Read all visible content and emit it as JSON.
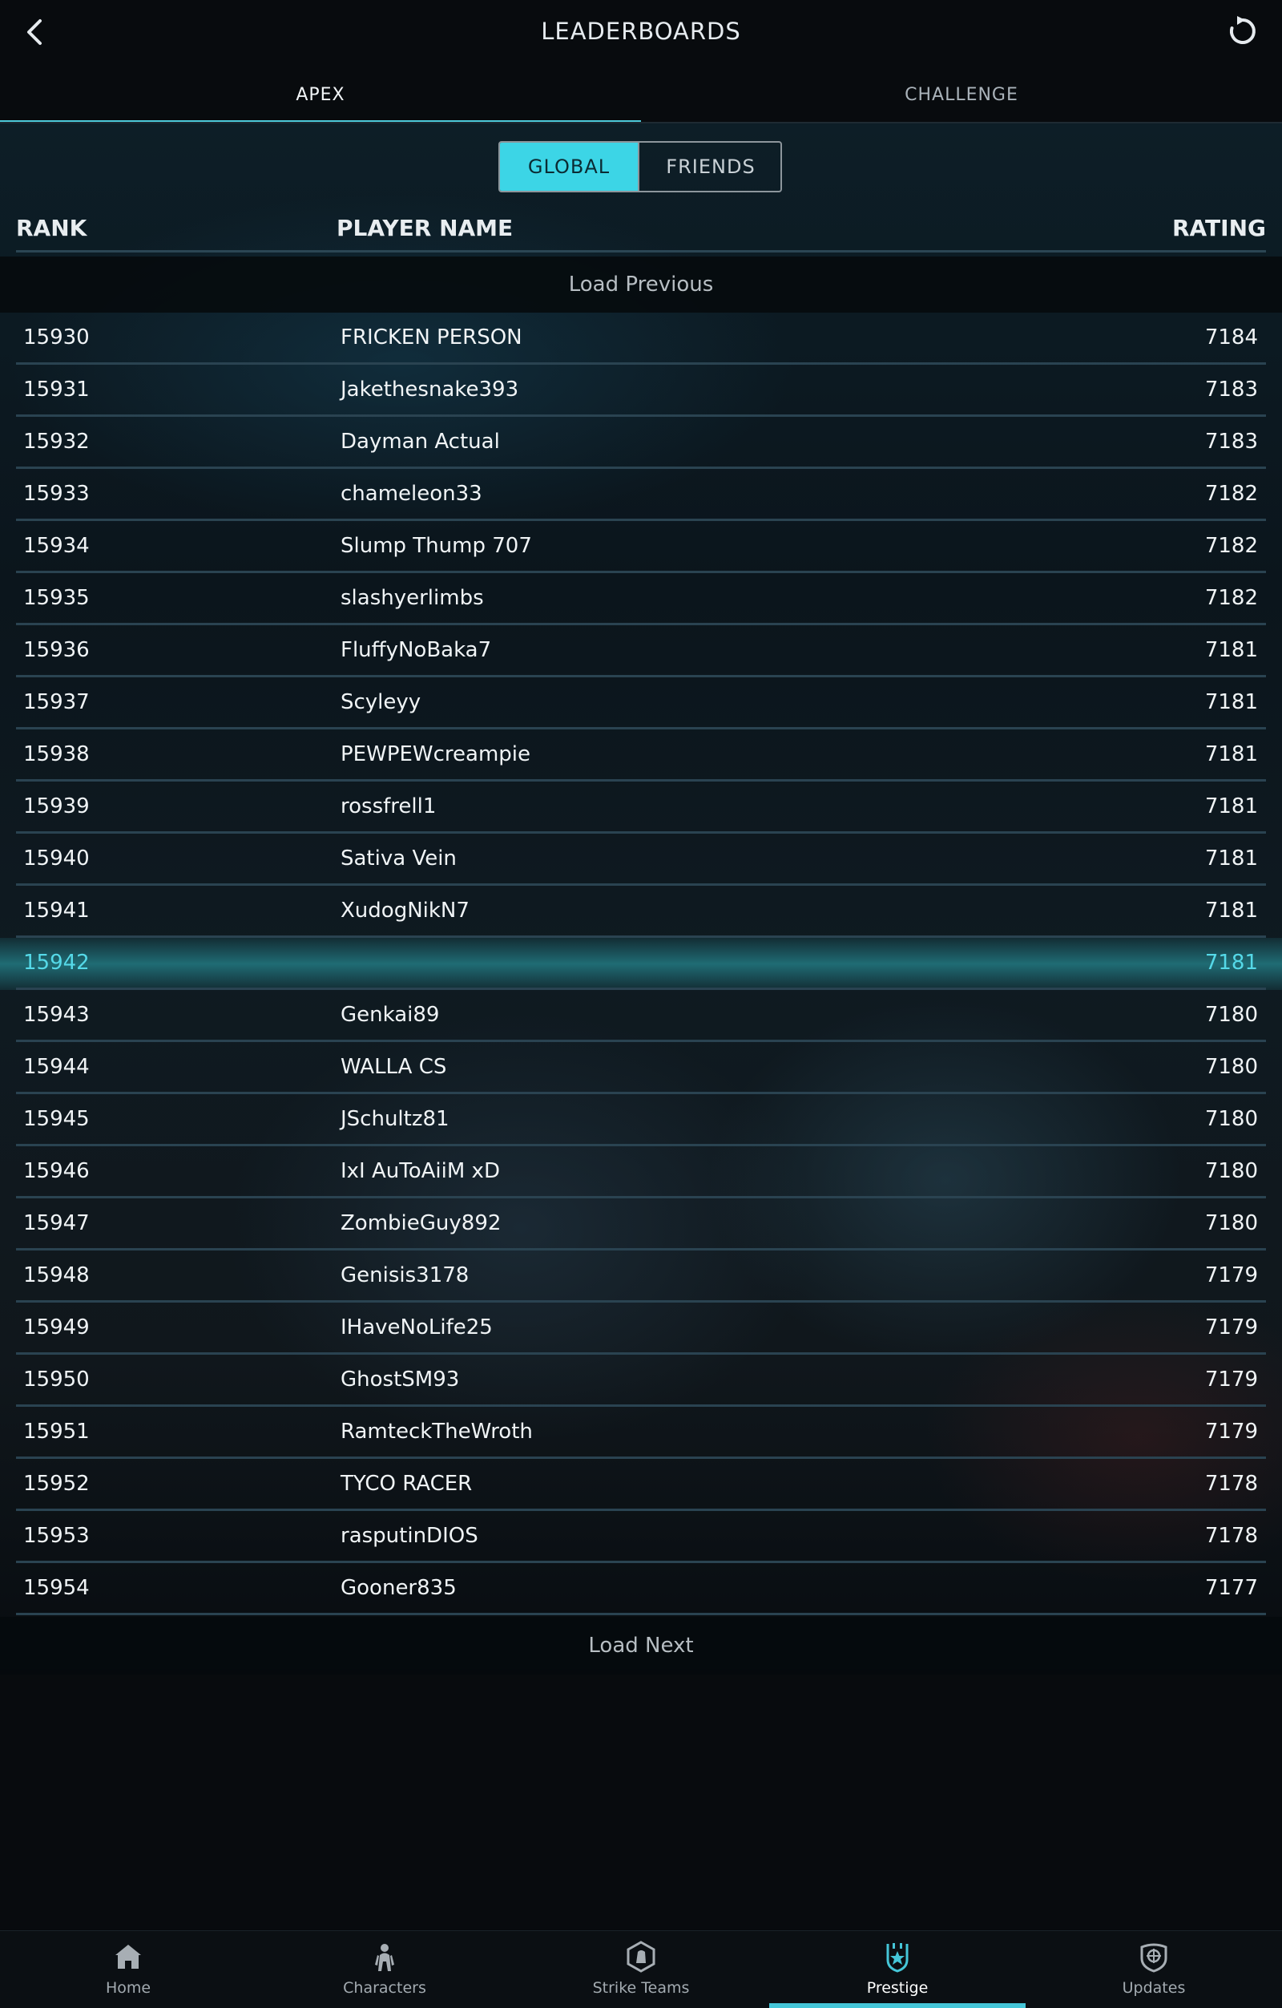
{
  "header": {
    "title": "LEADERBOARDS"
  },
  "tabs": [
    {
      "label": "APEX",
      "active": true
    },
    {
      "label": "CHALLENGE",
      "active": false
    }
  ],
  "scope_toggle": {
    "global_label": "GLOBAL",
    "friends_label": "FRIENDS",
    "selected": "GLOBAL"
  },
  "columns": {
    "rank": "RANK",
    "player": "PLAYER NAME",
    "rating": "RATING"
  },
  "load_previous": "Load Previous",
  "rows": [
    {
      "rank": "15930",
      "name": "FRICKEN PERSON",
      "rating": "7184"
    },
    {
      "rank": "15931",
      "name": "Jakethesnake393",
      "rating": "7183"
    },
    {
      "rank": "15932",
      "name": "Dayman Actual",
      "rating": "7183"
    },
    {
      "rank": "15933",
      "name": "chameleon33",
      "rating": "7182"
    },
    {
      "rank": "15934",
      "name": "Slump Thump 707",
      "rating": "7182"
    },
    {
      "rank": "15935",
      "name": "slashyerlimbs",
      "rating": "7182"
    },
    {
      "rank": "15936",
      "name": "FluffyNoBaka7",
      "rating": "7181"
    },
    {
      "rank": "15937",
      "name": "Scyleyy",
      "rating": "7181"
    },
    {
      "rank": "15938",
      "name": "PEWPEWcreampie",
      "rating": "7181"
    },
    {
      "rank": "15939",
      "name": "rossfrell1",
      "rating": "7181"
    },
    {
      "rank": "15940",
      "name": "Sativa Vein",
      "rating": "7181"
    },
    {
      "rank": "15941",
      "name": "XudogNikN7",
      "rating": "7181"
    },
    {
      "rank": "15942",
      "name": "",
      "rating": "7181",
      "highlighted": true
    },
    {
      "rank": "15943",
      "name": "Genkai89",
      "rating": "7180"
    },
    {
      "rank": "15944",
      "name": "WALLA CS",
      "rating": "7180"
    },
    {
      "rank": "15945",
      "name": "JSchultz81",
      "rating": "7180"
    },
    {
      "rank": "15946",
      "name": "IxI AuToAiiM xD",
      "rating": "7180"
    },
    {
      "rank": "15947",
      "name": "ZombieGuy892",
      "rating": "7180"
    },
    {
      "rank": "15948",
      "name": "Genisis3178",
      "rating": "7179"
    },
    {
      "rank": "15949",
      "name": "IHaveNoLife25",
      "rating": "7179"
    },
    {
      "rank": "15950",
      "name": "GhostSM93",
      "rating": "7179"
    },
    {
      "rank": "15951",
      "name": "RamteckTheWroth",
      "rating": "7179"
    },
    {
      "rank": "15952",
      "name": "TYCO RACER",
      "rating": "7178"
    },
    {
      "rank": "15953",
      "name": "rasputinDIOS",
      "rating": "7178"
    },
    {
      "rank": "15954",
      "name": "Gooner835",
      "rating": "7177"
    }
  ],
  "load_next": "Load Next",
  "nav": [
    {
      "label": "Home",
      "icon": "home-icon"
    },
    {
      "label": "Characters",
      "icon": "characters-icon"
    },
    {
      "label": "Strike Teams",
      "icon": "strike-teams-icon"
    },
    {
      "label": "Prestige",
      "icon": "prestige-icon",
      "active": true
    },
    {
      "label": "Updates",
      "icon": "updates-icon"
    }
  ],
  "colors": {
    "accent": "#3cd5e6",
    "highlight_text": "#55d9e8"
  }
}
